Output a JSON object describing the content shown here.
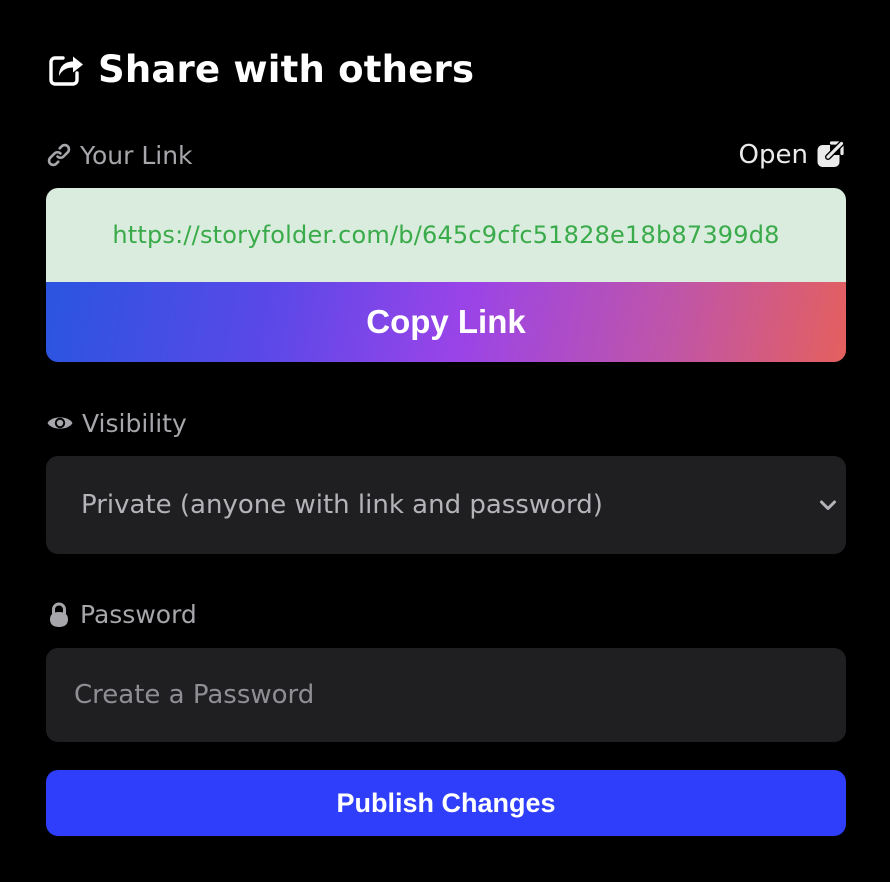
{
  "dialog": {
    "title": "Share with others",
    "title_icon": "share-icon"
  },
  "link_section": {
    "label": "Your Link",
    "label_icon": "link-icon",
    "open_label": "Open",
    "open_icon": "external-link-icon",
    "url": "https://storyfolder.com/b/645c9cfc51828e18b87399d8",
    "copy_button": "Copy Link"
  },
  "visibility_section": {
    "label": "Visibility",
    "label_icon": "eye-icon",
    "selected": "Private (anyone with link and password)",
    "chevron_icon": "chevron-down-icon"
  },
  "password_section": {
    "label": "Password",
    "label_icon": "lock-icon",
    "placeholder": "Create a Password",
    "value": ""
  },
  "actions": {
    "publish_button": "Publish Changes"
  },
  "colors": {
    "background": "#000000",
    "field_background": "#1f1f22",
    "url_background": "#d9ecdd",
    "url_text": "#3aab4a",
    "publish_button": "#2f3efb",
    "gradient_start": "#2a55e0",
    "gradient_mid": "#9a44e8",
    "gradient_end": "#e4605e"
  }
}
